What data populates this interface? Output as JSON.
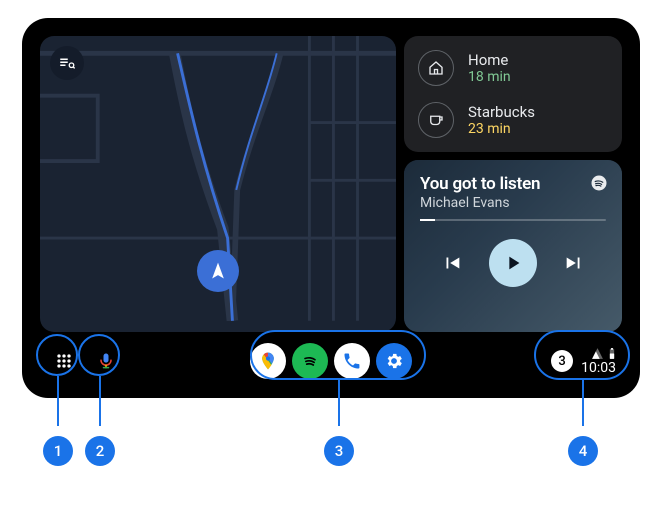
{
  "destinations": [
    {
      "name": "Home",
      "time": "18 min",
      "timeClass": "time-green",
      "icon": "home"
    },
    {
      "name": "Starbucks",
      "time": "23 min",
      "timeClass": "time-yellow",
      "icon": "cup"
    }
  ],
  "media": {
    "title": "You got to listen",
    "artist": "Michael Evans",
    "progress_pct": 8
  },
  "navbar": {
    "apps": [
      "maps",
      "spotify",
      "phone",
      "settings"
    ],
    "notifications": "3",
    "clock": "10:03"
  },
  "callouts": {
    "1": "1",
    "2": "2",
    "3": "3",
    "4": "4"
  }
}
